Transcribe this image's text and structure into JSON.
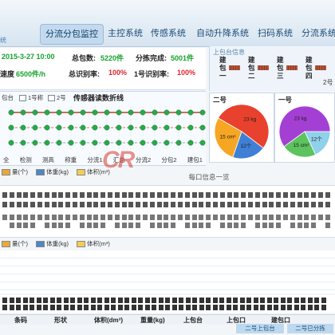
{
  "header": {
    "left_fragment": "统",
    "tabs": [
      {
        "label": "分流分包监控",
        "active": true
      },
      {
        "label": "主控系统"
      },
      {
        "label": "传感系统"
      },
      {
        "label": "自动升降系统"
      },
      {
        "label": "扫码系统"
      },
      {
        "label": "分流系统"
      }
    ]
  },
  "stats": {
    "datetime": "2015-3-27 10:00",
    "total_label": "总包数:",
    "total_value": "5220件",
    "sorted_label": "分拣完成:",
    "sorted_value": "5001件",
    "speed_label": "速度",
    "speed_value": "6500件/h",
    "recog_label": "总识别率:",
    "recog_value": "100%",
    "recog1_label": "1号识别率:",
    "recog1_value": "100%"
  },
  "upload_info": {
    "title": "上包台信息",
    "stations": [
      "建包一",
      "建包二",
      "建包三",
      "建包四"
    ],
    "edge_label": "2号"
  },
  "sensor_panel": {
    "left_label": "包台"
  },
  "mid": {
    "legend": [
      "量(个)",
      "体重(kg)",
      "体积(m³)"
    ],
    "caption": "每口信息一览"
  },
  "lower": {
    "legend": [
      "量(个)",
      "体重(kg)",
      "体积(m³)"
    ]
  },
  "table": {
    "headers": [
      "条码",
      "形状",
      "体积(dm³)",
      "重量(kg)",
      "上包台",
      "上包口",
      "建包口"
    ],
    "tags": [
      "二号上包台",
      "二号已分拣"
    ]
  },
  "logo": {
    "text": "CR"
  },
  "colors": {
    "active_tab": "#c3daee",
    "ok_green": "#17a22f",
    "alert_red": "#e0252c",
    "legend_count": "#e8a93c",
    "legend_weight": "#4f86c6",
    "legend_volume": "#f2cc55"
  },
  "chart_data": [
    {
      "type": "line",
      "title": "传感器读数折线",
      "categories": [
        "全",
        "检测",
        "测高",
        "称重",
        "分流1",
        "汇总",
        "分流2",
        "分包2",
        "建包1"
      ],
      "series": [
        {
          "name": "1号称",
          "points": 17,
          "dot_color": "#2aa84a",
          "link_color": "#b8432e"
        },
        {
          "name": "2号",
          "points": 17,
          "dot_color": "#2aa84a",
          "link_color": "#c97a5a"
        },
        {
          "points": 17,
          "dot_color": "#2aa84a",
          "link_color": "#9aa6b2"
        }
      ]
    },
    {
      "type": "pie",
      "title": "二号",
      "slices": [
        {
          "label": "23 kg",
          "value": 52,
          "color": "#e8412e"
        },
        {
          "label": "12个",
          "value": 20,
          "color": "#3f7fd6"
        },
        {
          "label": "15 cm³",
          "value": 28,
          "color": "#f6a623"
        }
      ]
    },
    {
      "type": "pie",
      "title": "一号",
      "slices": [
        {
          "label": "23 kg",
          "value": 60,
          "color": "#a43fd4"
        },
        {
          "label": "12个",
          "value": 18,
          "color": "#8fd0ea"
        },
        {
          "label": "15 cm²",
          "value": 22,
          "color": "#5cc35e"
        }
      ]
    }
  ]
}
